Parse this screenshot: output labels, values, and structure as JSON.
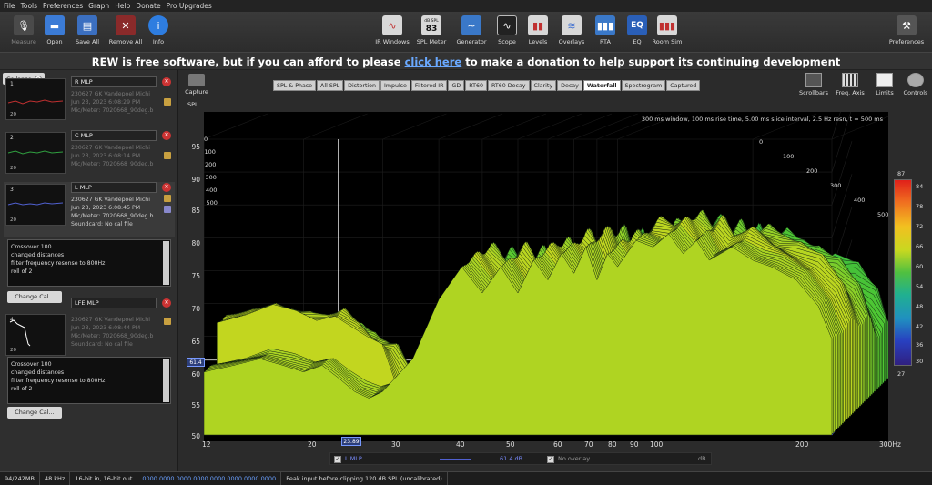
{
  "menu": [
    "File",
    "Tools",
    "Preferences",
    "Graph",
    "Help",
    "Donate",
    "Pro Upgrades"
  ],
  "toolbar_left": [
    {
      "label": "Measure",
      "icon": "microphone-icon",
      "disabled": true
    },
    {
      "label": "Open",
      "icon": "folder-icon",
      "disabled": false
    },
    {
      "label": "Save All",
      "icon": "save-icon",
      "disabled": false
    },
    {
      "label": "Remove All",
      "icon": "remove-icon",
      "disabled": false
    },
    {
      "label": "Info",
      "icon": "info-icon",
      "disabled": false
    }
  ],
  "toolbar_center": [
    {
      "label": "IR Windows",
      "icon": "ir-windows-icon"
    },
    {
      "label": "SPL Meter",
      "icon": "spl-meter-icon",
      "badge_top": "dB SPL",
      "badge": "83"
    },
    {
      "label": "Generator",
      "icon": "generator-icon"
    },
    {
      "label": "Scope",
      "icon": "scope-icon"
    },
    {
      "label": "Levels",
      "icon": "levels-icon"
    },
    {
      "label": "Overlays",
      "icon": "overlays-icon"
    },
    {
      "label": "RTA",
      "icon": "rta-icon"
    },
    {
      "label": "EQ",
      "icon": "eq-icon",
      "badge": "EQ"
    },
    {
      "label": "Room Sim",
      "icon": "room-sim-icon"
    }
  ],
  "toolbar_right": {
    "label": "Preferences",
    "icon": "preferences-icon"
  },
  "donate": {
    "prefix": "REW is free software, but if you can afford to please ",
    "link": "click here",
    "suffix": " to make a donation to help support its continuing development"
  },
  "collapse_label": "Collapse",
  "measurements": [
    {
      "index": "1",
      "name": "R MLP",
      "lines": [
        "230627 GK Vandepoel Michi",
        "Jun 23, 2023 6:08:29 PM",
        "Mic/Meter: 7020668_90deg.b"
      ],
      "trace": "#c03030",
      "axis": "20",
      "selected": false
    },
    {
      "index": "2",
      "name": "C MLP",
      "lines": [
        "230627 GK Vandepoel Michi",
        "Jun 23, 2023 6:08:14 PM",
        "Mic/Meter: 7020668_90deg.b"
      ],
      "trace": "#30a040",
      "axis": "20",
      "selected": false
    },
    {
      "index": "3",
      "name": "L MLP",
      "lines": [
        "230627 GK Vandepoel Michi",
        "Jun 23, 2023 6:08:45 PM",
        "Mic/Meter: 7020668_90deg.b",
        "Soundcard: No cal file"
      ],
      "trace": "#5060d0",
      "axis": "20",
      "selected": true
    },
    {
      "index": "4",
      "name": "LFE MLP",
      "lines": [
        "230627 GK Vandepoel Michi",
        "Jun 23, 2023 6:08:44 PM",
        "Mic/Meter: 7020668_90deg.b",
        "Soundcard: No cal file"
      ],
      "trace": "#ffffff",
      "axis": "20",
      "selected": false
    }
  ],
  "notes": [
    "Crossover 100",
    "changed distances",
    "filter frequency resonse to 800Hz",
    "roll of 2"
  ],
  "change_cal": "Change Cal...",
  "capture_label": "Capture",
  "spl_label": "SPL",
  "tabs": [
    "SPL & Phase",
    "All SPL",
    "Distortion",
    "Impulse",
    "Filtered IR",
    "GD",
    "RT60",
    "RT60 Decay",
    "Clarity",
    "Decay",
    "Waterfall",
    "Spectrogram",
    "Captured"
  ],
  "active_tab": "Waterfall",
  "right_tools": [
    {
      "label": "Scrollbars",
      "icon": "scrollbars-icon"
    },
    {
      "label": "Freq. Axis",
      "icon": "freq-axis-icon"
    },
    {
      "label": "Limits",
      "icon": "limits-icon"
    },
    {
      "label": "Controls",
      "icon": "controls-icon"
    }
  ],
  "chart_caption": "300 ms window, 100 ms rise time, 5.00 ms slice interval, 2.5 Hz resn, t = 500 ms",
  "chart_data": {
    "type": "area",
    "title": "",
    "xlabel": "",
    "ylabel": "",
    "x_ticks": [
      "12",
      "20",
      "30",
      "40",
      "50",
      "60",
      "70",
      "80",
      "90",
      "100",
      "200",
      "300Hz"
    ],
    "x_scale": "log",
    "xlim": [
      12,
      300
    ],
    "y_ticks": [
      "95",
      "90",
      "85",
      "80",
      "75",
      "70",
      "65",
      "60",
      "55",
      "50"
    ],
    "ylim": [
      50,
      95
    ],
    "time_ticks": [
      "0",
      "100",
      "200",
      "300",
      "400",
      "500"
    ],
    "time_unit": "ms",
    "colorbar_ticks": [
      "87",
      "84",
      "78",
      "72",
      "66",
      "60",
      "54",
      "48",
      "42",
      "36",
      "30",
      "27"
    ],
    "cursor": {
      "freq": "23.89",
      "level": "61.4"
    },
    "front_slice": {
      "x": [
        12,
        14,
        16,
        18,
        20,
        22,
        24,
        26,
        28,
        30,
        35,
        40,
        45,
        50,
        55,
        60,
        65,
        70,
        75,
        80,
        85,
        90,
        95,
        100,
        110,
        120,
        130,
        140,
        150,
        160,
        180,
        200,
        220,
        250,
        280,
        300
      ],
      "y": [
        56,
        57,
        58,
        57,
        56,
        57,
        55,
        53,
        52,
        53,
        58,
        67,
        72,
        68,
        72,
        68,
        73,
        70,
        74,
        71,
        75,
        70,
        74,
        72,
        76,
        75,
        77,
        74,
        76,
        73,
        75,
        73,
        72,
        70,
        66,
        61
      ]
    }
  },
  "legend": {
    "name": "L MLP",
    "value": "61.4 dB",
    "overlay": "No overlay",
    "unit": "dB"
  },
  "status": [
    "94/242MB",
    "48 kHz",
    "16-bit in, 16-bit out",
    "0000 0000  0000 0000  0000 0000  0000 0000",
    "Peak input before clipping 120 dB SPL (uncalibrated)"
  ]
}
